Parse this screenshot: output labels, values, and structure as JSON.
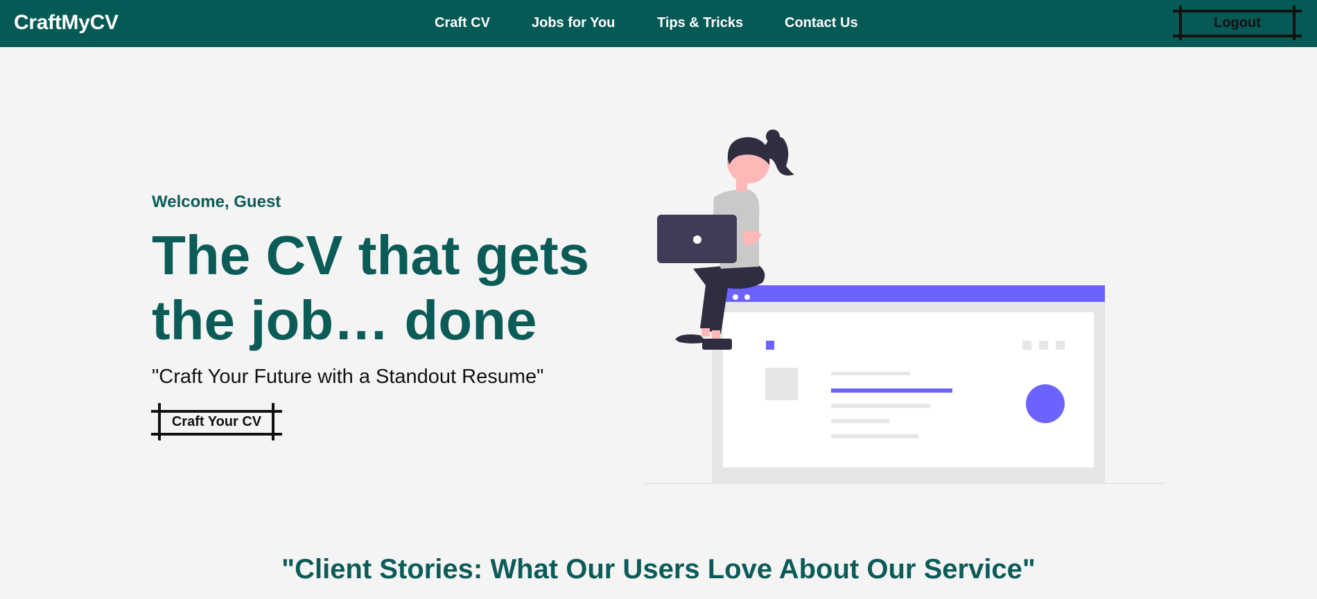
{
  "navbar": {
    "brand": "CraftMyCV",
    "links": [
      "Craft CV",
      "Jobs for You",
      "Tips & Tricks",
      "Contact Us"
    ],
    "logout_label": "Logout"
  },
  "hero": {
    "welcome": "Welcome, Guest",
    "headline": "The CV that gets the job… done",
    "tagline": "\"Craft Your Future with a Standout Resume\"",
    "cta_label": "Craft Your CV"
  },
  "testimonials": {
    "heading": "\"Client Stories: What Our Users Love About Our Service\""
  },
  "colors": {
    "nav_bg": "#055a55",
    "accent_text": "#0b5b57",
    "illustration_purple": "#6c63ff",
    "page_bg": "#f4f4f4"
  }
}
